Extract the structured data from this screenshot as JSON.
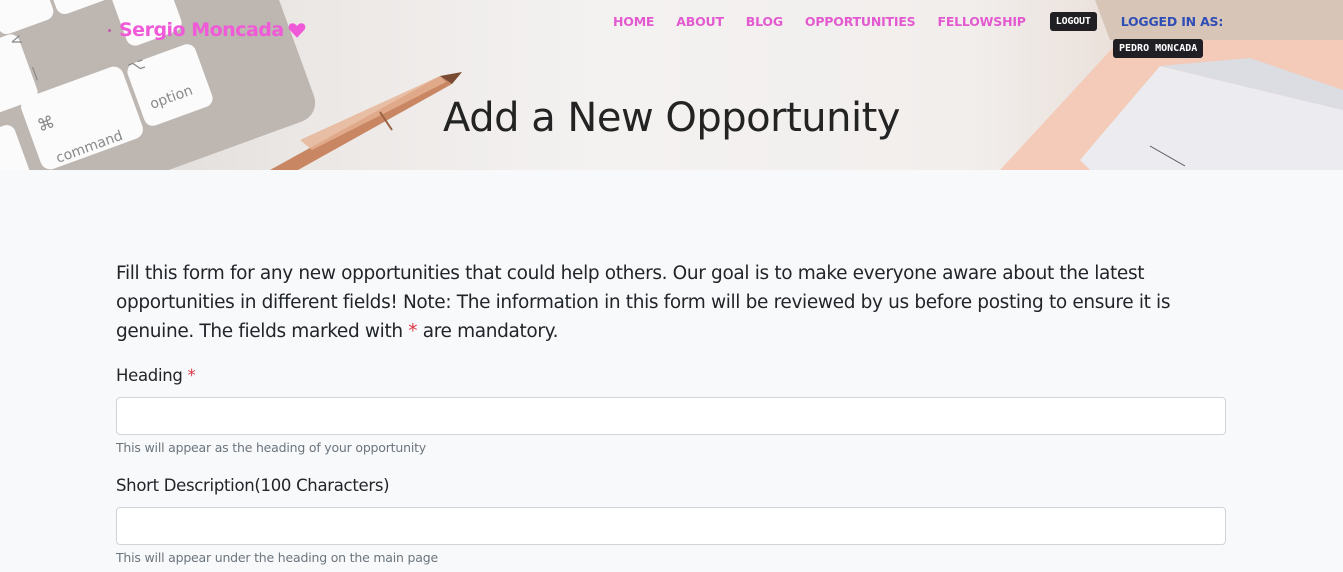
{
  "header": {
    "brand": "Sergio Moncada",
    "brand_icon": "heart-icon",
    "nav": [
      {
        "label": "HOME"
      },
      {
        "label": "ABOUT"
      },
      {
        "label": "BLOG"
      },
      {
        "label": "OPPORTUNITIES"
      },
      {
        "label": "FELLOWSHIP"
      }
    ],
    "logout_label": "LOGOUT",
    "logged_in_label": "LOGGED IN AS:",
    "username": "PEDRO MONCADA",
    "hero_title": "Add a New Opportunity",
    "hero_keys": {
      "command": "command",
      "option": "option",
      "command_symbol": "⌘",
      "option_symbol": "⌥"
    }
  },
  "colors": {
    "brand": "#f05ad8",
    "nav_link": "#e35ad0",
    "logged_in": "#2f4eb5",
    "required": "#dc3545"
  },
  "form": {
    "intro": "Fill this form for any new opportunities that could help others. Our goal is to make everyone aware about the latest opportunities in different fields! Note: The information in this form will be reviewed by us before posting to ensure it is genuine. The fields marked with ",
    "intro_required_mark": "*",
    "intro_end": " are mandatory.",
    "fields": [
      {
        "label": "Heading",
        "required_mark": "*",
        "value": "",
        "placeholder": "",
        "help": "This will appear as the heading of your opportunity"
      },
      {
        "label": "Short Description(100 Characters)",
        "value": "",
        "placeholder": "",
        "help": "This will appear under the heading on the main page"
      }
    ]
  }
}
